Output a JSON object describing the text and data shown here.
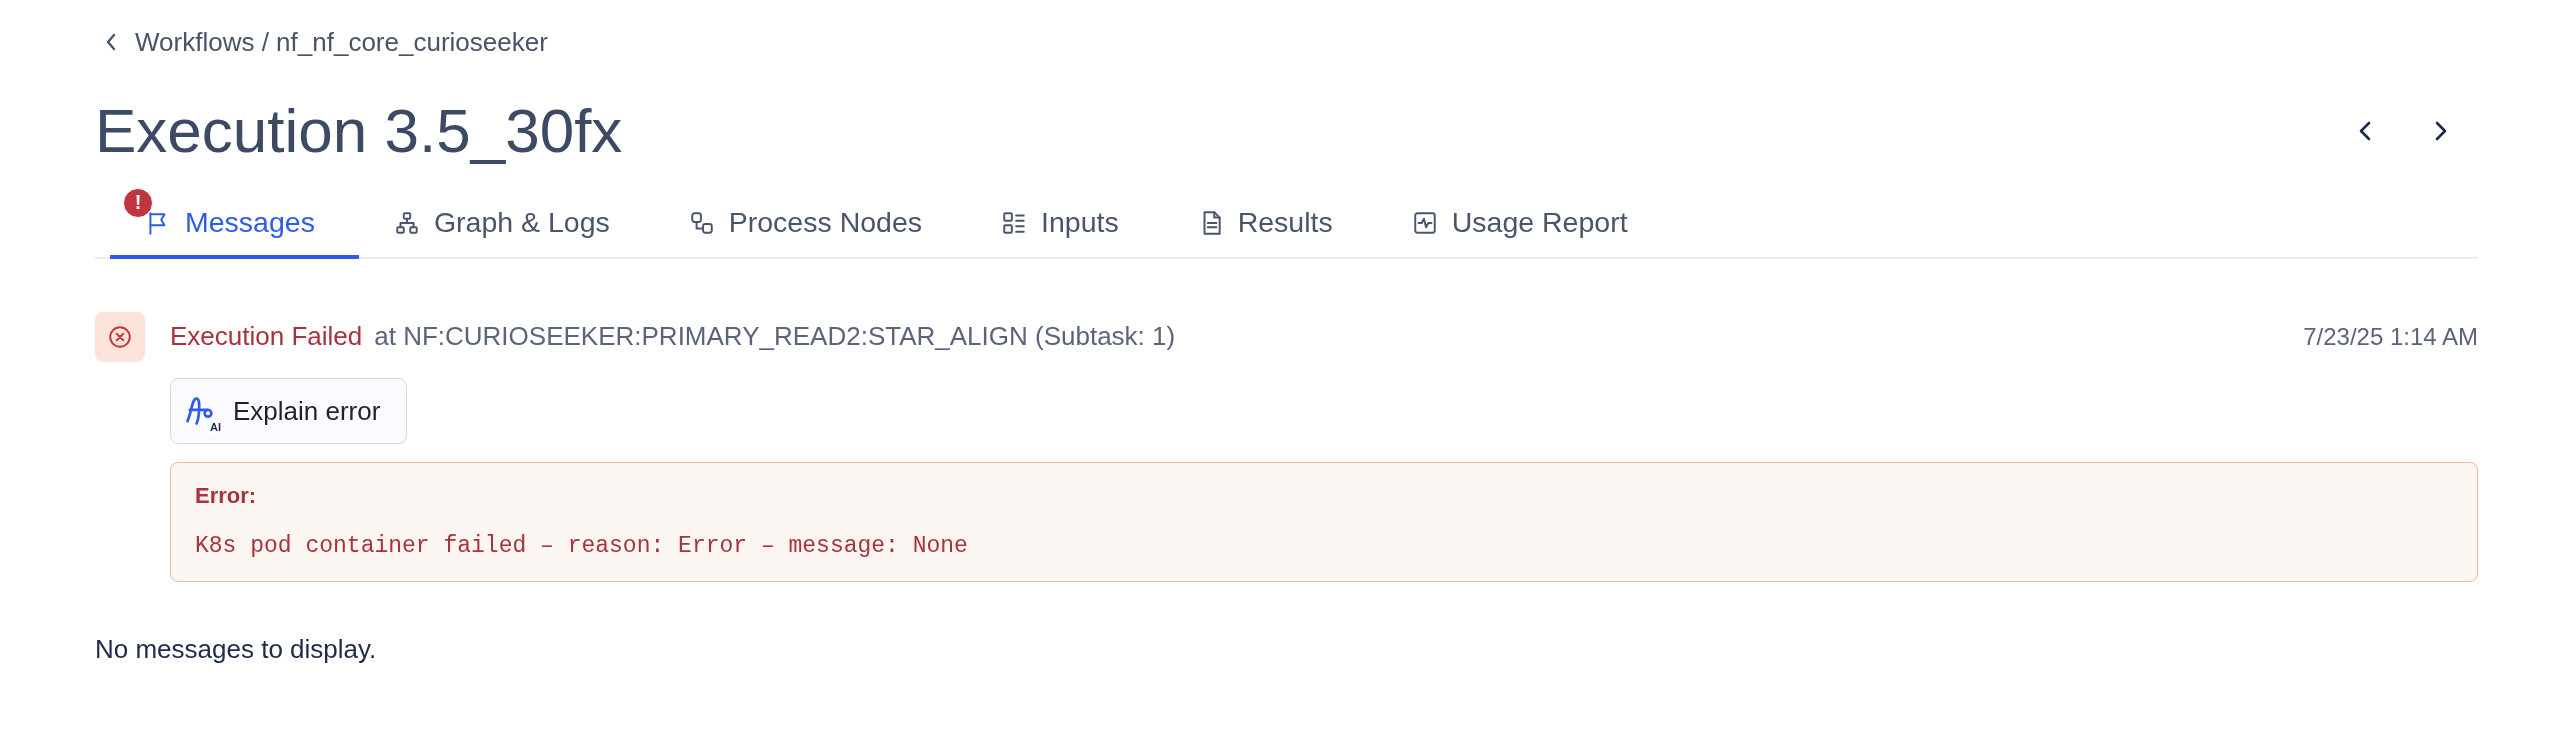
{
  "breadcrumb": {
    "text": "Workflows / nf_nf_core_curioseeker"
  },
  "title": "Execution 3.5_30fx",
  "tabs": [
    {
      "label": "Messages",
      "selected": true,
      "badge": "!"
    },
    {
      "label": "Graph & Logs",
      "selected": false
    },
    {
      "label": "Process Nodes",
      "selected": false
    },
    {
      "label": "Inputs",
      "selected": false
    },
    {
      "label": "Results",
      "selected": false
    },
    {
      "label": "Usage Report",
      "selected": false
    }
  ],
  "event": {
    "status": "Execution Failed",
    "location": "at NF:CURIOSEEKER:PRIMARY_READ2:STAR_ALIGN (Subtask: 1)",
    "time": "7/23/25 1:14 AM",
    "explain_button": {
      "label": "Explain error",
      "badge": "AI"
    },
    "error": {
      "heading": "Error:",
      "message": "K8s pod container failed – reason: Error – message: None"
    }
  },
  "empty_text": "No messages to display."
}
